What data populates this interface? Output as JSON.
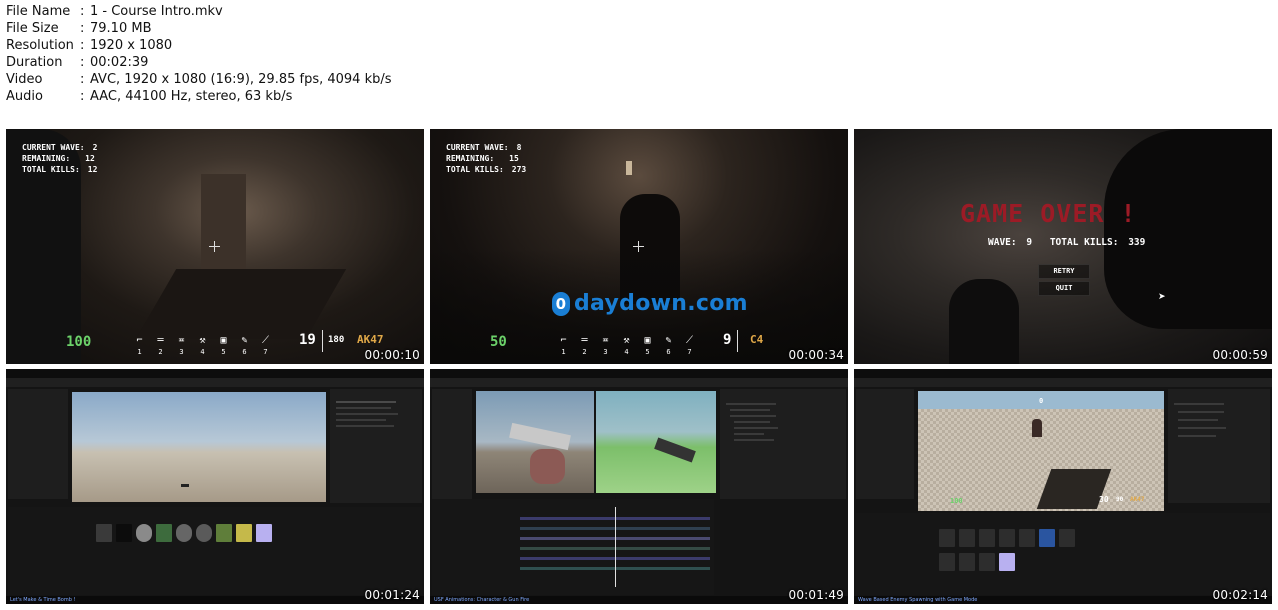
{
  "file_info": {
    "rows": [
      {
        "key": "File Name",
        "sep": ":",
        "value": "1 - Course Intro.mkv"
      },
      {
        "key": "File Size",
        "sep": ":",
        "value": "79.10 MB"
      },
      {
        "key": "Resolution",
        "sep": ":",
        "value": "1920 x 1080"
      },
      {
        "key": "Duration",
        "sep": ":",
        "value": "00:02:39"
      },
      {
        "key": "Video",
        "sep": ":",
        "value": "AVC, 1920 x 1080 (16:9), 29.85 fps, 4094 kb/s"
      },
      {
        "key": "Audio",
        "sep": ":",
        "value": "AAC, 44100 Hz, stereo, 63 kb/s"
      }
    ]
  },
  "thumbnails": {
    "t1": {
      "timestamp": "00:00:10",
      "hud": {
        "wave_label": "CURRENT WAVE:",
        "wave": "2",
        "remaining_label": "REMAINING:",
        "remaining": "12",
        "kills_label": "TOTAL KILLS:",
        "kills": "12",
        "health": "100",
        "ammo": "19",
        "reserve": "180",
        "gun": "AK47",
        "slots": [
          "1",
          "2",
          "3",
          "4",
          "5",
          "6",
          "7"
        ]
      }
    },
    "t2": {
      "timestamp": "00:00:34",
      "hud": {
        "wave_label": "CURRENT WAVE:",
        "wave": "8",
        "remaining_label": "REMAINING:",
        "remaining": "15",
        "kills_label": "TOTAL KILLS:",
        "kills": "273",
        "health": "50",
        "ammo": "9",
        "gun": "C4",
        "slots": [
          "1",
          "2",
          "3",
          "4",
          "5",
          "6",
          "7"
        ]
      },
      "watermark": {
        "badge": "0",
        "text": "daydown.com"
      }
    },
    "t3": {
      "timestamp": "00:00:59",
      "title": "GAME OVER !",
      "wave_label": "WAVE:",
      "wave": "9",
      "kills_label": "TOTAL KILLS:",
      "kills": "339",
      "retry": "RETRY",
      "quit": "QUIT"
    },
    "t4": {
      "timestamp": "00:01:24",
      "caption": "Let's Make & Time Bomb !"
    },
    "t5": {
      "timestamp": "00:01:49",
      "caption": "USF Animations: Character & Gun Fire"
    },
    "t6": {
      "timestamp": "00:02:14",
      "caption": "Wave Based Enemy Spawning with Game Mode",
      "hud": {
        "health": "100",
        "ammo": "30",
        "reserve": "90",
        "gun": "AK47",
        "wave": "0"
      }
    }
  },
  "colors": {
    "hud_health": "#6cd26a",
    "hud_gun": "#e0a848",
    "game_over": "#9c1b26",
    "watermark": "#1a7ed4"
  },
  "icons": [
    "pistol-icon",
    "rifle-icon",
    "smg-icon",
    "axe-icon",
    "bomb-icon",
    "syringe-icon",
    "knife-icon"
  ]
}
